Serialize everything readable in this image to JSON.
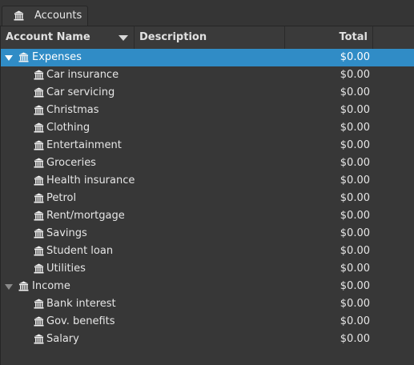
{
  "tab": {
    "label": "Accounts",
    "icon": "bank-icon"
  },
  "columns": {
    "name": "Account Name",
    "description": "Description",
    "total": "Total"
  },
  "accounts": [
    {
      "name": "Expenses",
      "total": "$0.00",
      "level": 0,
      "expanded": true,
      "selected": true,
      "children": [
        {
          "name": "Car insurance",
          "total": "$0.00"
        },
        {
          "name": "Car servicing",
          "total": "$0.00"
        },
        {
          "name": "Christmas",
          "total": "$0.00"
        },
        {
          "name": "Clothing",
          "total": "$0.00"
        },
        {
          "name": "Entertainment",
          "total": "$0.00"
        },
        {
          "name": "Groceries",
          "total": "$0.00"
        },
        {
          "name": "Health insurance",
          "total": "$0.00"
        },
        {
          "name": "Petrol",
          "total": "$0.00"
        },
        {
          "name": "Rent/mortgage",
          "total": "$0.00"
        },
        {
          "name": "Savings",
          "total": "$0.00"
        },
        {
          "name": "Student loan",
          "total": "$0.00"
        },
        {
          "name": "Utilities",
          "total": "$0.00"
        }
      ]
    },
    {
      "name": "Income",
      "total": "$0.00",
      "level": 0,
      "expanded": true,
      "selected": false,
      "children": [
        {
          "name": "Bank interest",
          "total": "$0.00"
        },
        {
          "name": "Gov. benefits",
          "total": "$0.00"
        },
        {
          "name": "Salary",
          "total": "$0.00"
        }
      ]
    }
  ],
  "colors": {
    "selection": "#308cc6",
    "background": "#373737",
    "text": "#e6e6e6"
  }
}
